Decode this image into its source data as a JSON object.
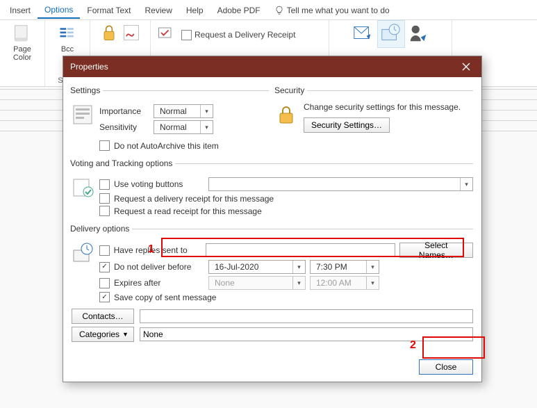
{
  "tabs": {
    "insert": "Insert",
    "options": "Options",
    "format_text": "Format Text",
    "review": "Review",
    "help": "Help",
    "adobe": "Adobe PDF",
    "tell_me": "Tell me what you want to do"
  },
  "ribbon": {
    "page_color": "Page Color",
    "bcc": "Bcc",
    "request_delivery_receipt": "Request a Delivery Receipt",
    "show": "Show"
  },
  "dialog": {
    "title": "Properties",
    "sections": {
      "settings": "Settings",
      "security": "Security",
      "voting": "Voting and Tracking options",
      "delivery": "Delivery options"
    },
    "settings": {
      "importance_label": "Importance",
      "importance_value": "Normal",
      "sensitivity_label": "Sensitivity",
      "sensitivity_value": "Normal",
      "dont_autoarchive": "Do not AutoArchive this item"
    },
    "security": {
      "change_text": "Change security settings for this message.",
      "button": "Security Settings…"
    },
    "voting": {
      "use_voting": "Use voting buttons",
      "req_delivery": "Request a delivery receipt for this message",
      "req_read": "Request a read receipt for this message"
    },
    "delivery": {
      "have_replies": "Have replies sent to",
      "select_names": "Select Names…",
      "do_not_deliver": "Do not deliver before",
      "date_value": "16-Jul-2020",
      "time_value": "7:30 PM",
      "expires_after": "Expires after",
      "expires_date": "None",
      "expires_time": "12:00 AM",
      "save_copy": "Save copy of sent message",
      "contacts_btn": "Contacts…",
      "categories_btn": "Categories",
      "categories_value": "None",
      "close": "Close"
    }
  },
  "annotations": {
    "one": "1",
    "two": "2"
  }
}
